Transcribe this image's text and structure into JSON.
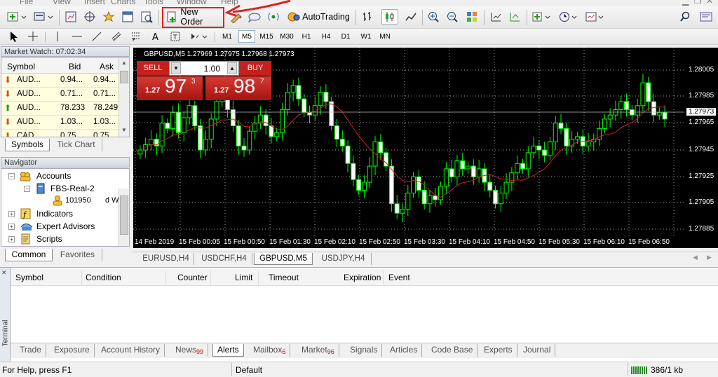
{
  "menu": [
    "File",
    "View",
    "Insert",
    "Charts",
    "Tools",
    "Window",
    "Help"
  ],
  "toolbar": {
    "new_order": "New Order",
    "autotrading": "AutoTrading"
  },
  "timeframes": [
    "M1",
    "M5",
    "M15",
    "M30",
    "H1",
    "H4",
    "D1",
    "W1",
    "MN"
  ],
  "active_timeframe": "M5",
  "market_watch": {
    "title": "Market Watch: 07:02:34",
    "headers": [
      "Symbol",
      "Bid",
      "Ask"
    ],
    "rows": [
      {
        "symbol": "AUD...",
        "bid": "0.94...",
        "ask": "0.94...",
        "dir": "down"
      },
      {
        "symbol": "AUD...",
        "bid": "0.71...",
        "ask": "0.71...",
        "dir": "down"
      },
      {
        "symbol": "AUD...",
        "bid": "78.233",
        "ask": "78.249",
        "dir": "up"
      },
      {
        "symbol": "AUD...",
        "bid": "1.03...",
        "ask": "1.03...",
        "dir": "down"
      },
      {
        "symbol": "CAD...",
        "bid": "0.75...",
        "ask": "0.75...",
        "dir": "down"
      }
    ],
    "tabs": [
      "Symbols",
      "Tick Chart"
    ]
  },
  "navigator": {
    "title": "Navigator",
    "items": [
      "Accounts",
      "FBS-Real-2",
      "101950",
      "d W",
      "Indicators",
      "Expert Advisors",
      "Scripts"
    ],
    "tabs": [
      "Common",
      "Favorites"
    ]
  },
  "chart": {
    "header": "GBPUSD,M5  1.27969 1.27975 1.27968 1.27973",
    "sell_label": "SELL",
    "buy_label": "BUY",
    "lot": "1.00",
    "sell_small": "1.27",
    "sell_big": "97",
    "sell_sup": "3",
    "buy_small": "1.27",
    "buy_big": "98",
    "buy_sup": "7",
    "price_labels": [
      "1.28005",
      "1.27985",
      "1.27973",
      "1.27965",
      "1.27945",
      "1.27925",
      "1.27905",
      "1.27885"
    ],
    "current_price": "1.27973",
    "time_labels": [
      "14 Feb 2019",
      "15 Feb 00:05",
      "15 Feb 00:50",
      "15 Feb 01:30",
      "15 Feb 02:10",
      "15 Feb 02:50",
      "15 Feb 03:30",
      "15 Feb 04:10",
      "15 Feb 04:50",
      "15 Feb 05:30",
      "15 Feb 06:10",
      "15 Feb 06:50"
    ],
    "tabs": [
      "EURUSD,H4",
      "USDCHF,H4",
      "GBPUSD,M5",
      "USDJPY,H4"
    ],
    "active_tab": "GBPUSD,M5"
  },
  "chart_data": {
    "type": "candlestick",
    "symbol": "GBPUSD",
    "timeframe": "M5",
    "ylim": [
      1.2788,
      1.28015
    ],
    "grid": true,
    "close": [
      1.27942,
      1.27946,
      1.2795,
      1.27945,
      1.27962,
      1.27958,
      1.2797,
      1.27955,
      1.27966,
      1.27975,
      1.2796,
      1.27942,
      1.2795,
      1.27965,
      1.27978,
      1.27982,
      1.27972,
      1.2796,
      1.27945,
      1.27942,
      1.27956,
      1.27962,
      1.27968,
      1.2796,
      1.27952,
      1.27955,
      1.27972,
      1.27985,
      1.2799,
      1.2798,
      1.2797,
      1.27968,
      1.27975,
      1.27985,
      1.27978,
      1.2796,
      1.2795,
      1.27945,
      1.27932,
      1.2792,
      1.27912,
      1.27918,
      1.2793,
      1.27948,
      1.2794,
      1.2793,
      1.27902,
      1.27895,
      1.27898,
      1.2791,
      1.27922,
      1.27912,
      1.27902,
      1.27908,
      1.27905,
      1.27915,
      1.27928,
      1.27922,
      1.27934,
      1.27928,
      1.2793,
      1.27922,
      1.27928,
      1.27918,
      1.27912,
      1.27902,
      1.2791,
      1.27918,
      1.27925,
      1.27932,
      1.27928,
      1.2794,
      1.27945,
      1.27942,
      1.27938,
      1.27948,
      1.27962,
      1.27958,
      1.27945,
      1.2795,
      1.27952,
      1.27945,
      1.27948,
      1.2795,
      1.27958,
      1.27965,
      1.27968,
      1.27972,
      1.27978,
      1.27972,
      1.27968,
      1.27975,
      1.27992,
      1.27978,
      1.27968,
      1.2797,
      1.27965
    ]
  },
  "terminal": {
    "label": "Terminal",
    "headers": [
      "Symbol",
      "Condition",
      "Counter",
      "Limit",
      "Timeout",
      "Expiration",
      "Event"
    ],
    "tabs": [
      {
        "label": "Trade",
        "badge": ""
      },
      {
        "label": "Exposure",
        "badge": ""
      },
      {
        "label": "Account History",
        "badge": ""
      },
      {
        "label": "News",
        "badge": "99"
      },
      {
        "label": "Alerts",
        "badge": ""
      },
      {
        "label": "Mailbox",
        "badge": "6"
      },
      {
        "label": "Market",
        "badge": "96"
      },
      {
        "label": "Signals",
        "badge": ""
      },
      {
        "label": "Articles",
        "badge": ""
      },
      {
        "label": "Code Base",
        "badge": ""
      },
      {
        "label": "Experts",
        "badge": ""
      },
      {
        "label": "Journal",
        "badge": ""
      }
    ],
    "active_tab": "Alerts"
  },
  "status": {
    "help": "For Help, press F1",
    "profile": "Default",
    "traffic": "386/1 kb"
  },
  "colors": {
    "chart_bg": "#000000",
    "candle": "#00ff00",
    "ma": "#cc1f1f",
    "sell": "#c3201e",
    "annotation": "#e02020"
  }
}
